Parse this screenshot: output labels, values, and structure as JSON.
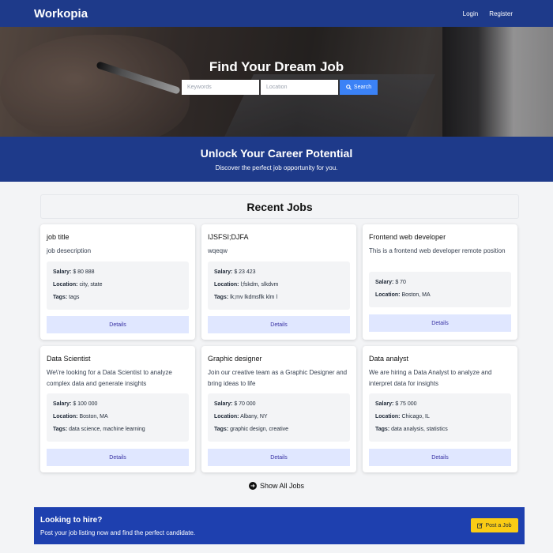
{
  "nav": {
    "brand": "Workopia",
    "login": "Login",
    "register": "Register"
  },
  "hero": {
    "title": "Find Your Dream Job",
    "keywords_placeholder": "Keywords",
    "location_placeholder": "Location",
    "search_label": "Search",
    "search_icon": "search-icon"
  },
  "banner": {
    "title": "Unlock Your Career Potential",
    "subtitle": "Discover the perfect job opportunity for you."
  },
  "recent": {
    "heading": "Recent Jobs",
    "labels": {
      "salary": "Salary:",
      "location": "Location:",
      "tags": "Tags:"
    },
    "details_label": "Details",
    "jobs": [
      {
        "title": "job title",
        "description": "job desecription",
        "salary": "$ 80 888",
        "location": "city, state",
        "tags": "tags"
      },
      {
        "title": "IJSFSI;DJFA",
        "description": "wqeqw",
        "salary": "$ 23 423",
        "location": "l;fskdm, slkdvm",
        "tags": "lk;mv lkdmsflk klm l"
      },
      {
        "title": "Frontend web developer",
        "description": "This is a frontend web developer remote position",
        "salary": "$ 70",
        "location": "Boston, MA",
        "tags": ""
      },
      {
        "title": "Data Scientist",
        "description": "We\\'re looking for a Data Scientist to analyze complex data and generate insights",
        "salary": "$ 100 000",
        "location": "Boston, MA",
        "tags": "data science, machine learning"
      },
      {
        "title": "Graphic designer",
        "description": "Join our creative team as a Graphic Designer and bring ideas to life",
        "salary": "$ 70 000",
        "location": "Albany, NY",
        "tags": "graphic design, creative"
      },
      {
        "title": "Data analyst",
        "description": "We are hiring a Data Analyst to analyze and interpret data for insights",
        "salary": "$ 75 000",
        "location": "Chicago, IL",
        "tags": "data analysis, statistics"
      }
    ],
    "show_all": "Show All Jobs",
    "show_all_icon": "arrow-circle-right-icon"
  },
  "cta": {
    "title": "Looking to hire?",
    "subtitle": "Post your job listing now and find the perfect candidate.",
    "button": "Post a Job",
    "button_icon": "edit-icon"
  },
  "colors": {
    "primary": "#1e3a8a",
    "accent": "#3b82f6",
    "cta_button": "#facc15",
    "details_button": "#e0e7ff"
  }
}
